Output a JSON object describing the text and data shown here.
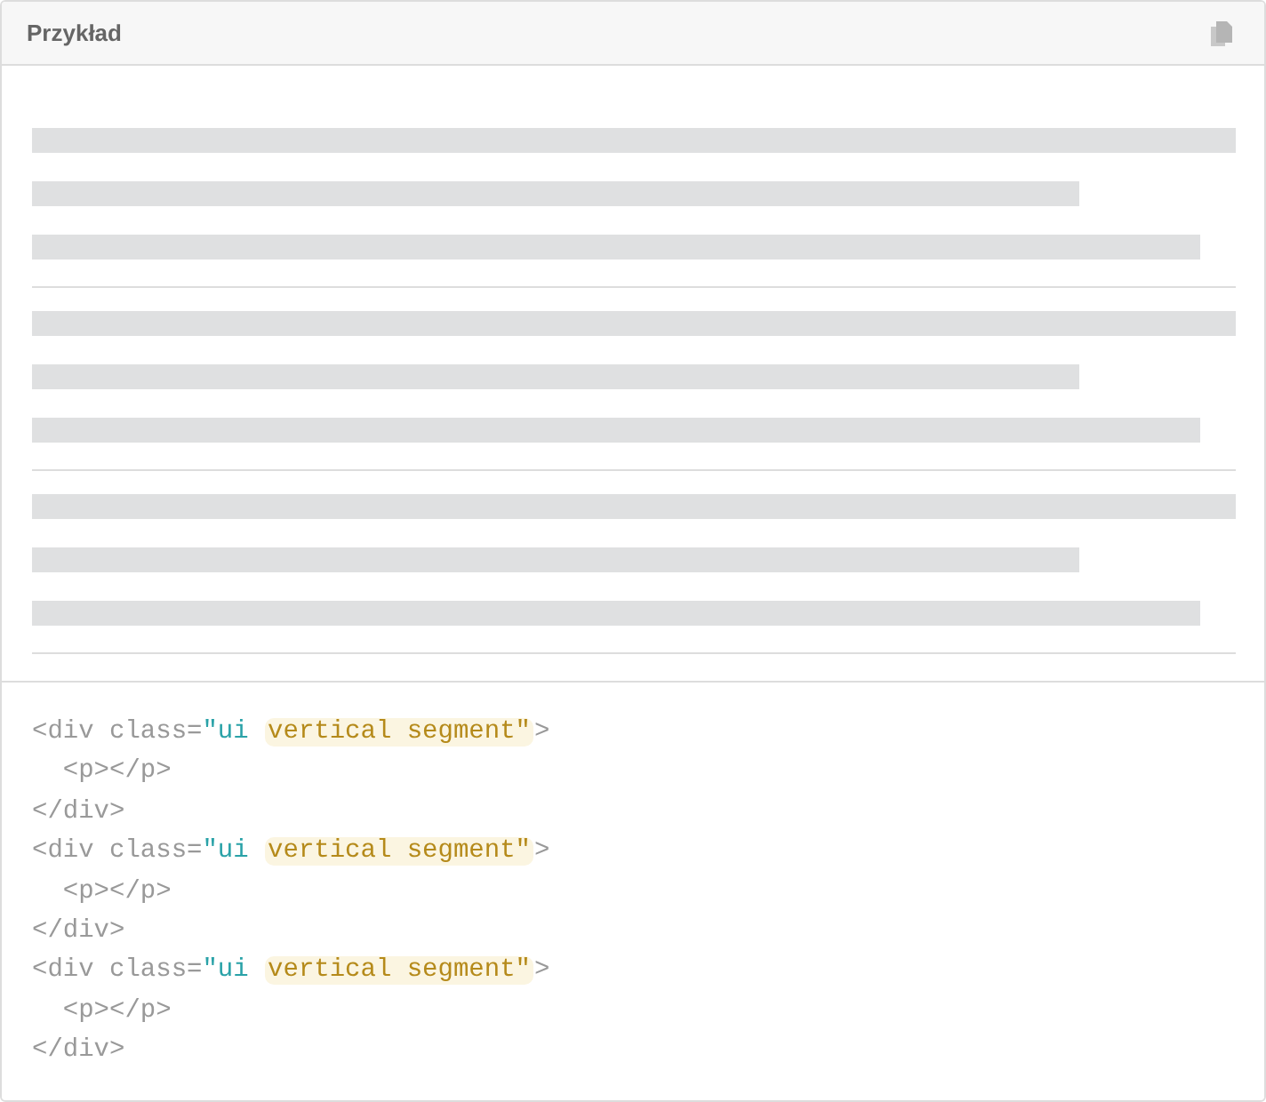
{
  "header": {
    "title": "Przykład"
  },
  "code": [
    [
      {
        "kind": "tag",
        "text": "<div "
      },
      {
        "kind": "attr",
        "text": "class="
      },
      {
        "kind": "string",
        "text": "\"ui "
      },
      {
        "kind": "highlight",
        "text": "vertical segment\""
      },
      {
        "kind": "tag",
        "text": ">"
      }
    ],
    [
      {
        "kind": "tag",
        "text": "  <p></p>"
      }
    ],
    [
      {
        "kind": "tag",
        "text": "</div>"
      }
    ],
    [
      {
        "kind": "tag",
        "text": "<div "
      },
      {
        "kind": "attr",
        "text": "class="
      },
      {
        "kind": "string",
        "text": "\"ui "
      },
      {
        "kind": "highlight",
        "text": "vertical segment\""
      },
      {
        "kind": "tag",
        "text": ">"
      }
    ],
    [
      {
        "kind": "tag",
        "text": "  <p></p>"
      }
    ],
    [
      {
        "kind": "tag",
        "text": "</div>"
      }
    ],
    [
      {
        "kind": "tag",
        "text": "<div "
      },
      {
        "kind": "attr",
        "text": "class="
      },
      {
        "kind": "string",
        "text": "\"ui "
      },
      {
        "kind": "highlight",
        "text": "vertical segment\""
      },
      {
        "kind": "tag",
        "text": ">"
      }
    ],
    [
      {
        "kind": "tag",
        "text": "  <p></p>"
      }
    ],
    [
      {
        "kind": "tag",
        "text": "</div>"
      }
    ]
  ]
}
